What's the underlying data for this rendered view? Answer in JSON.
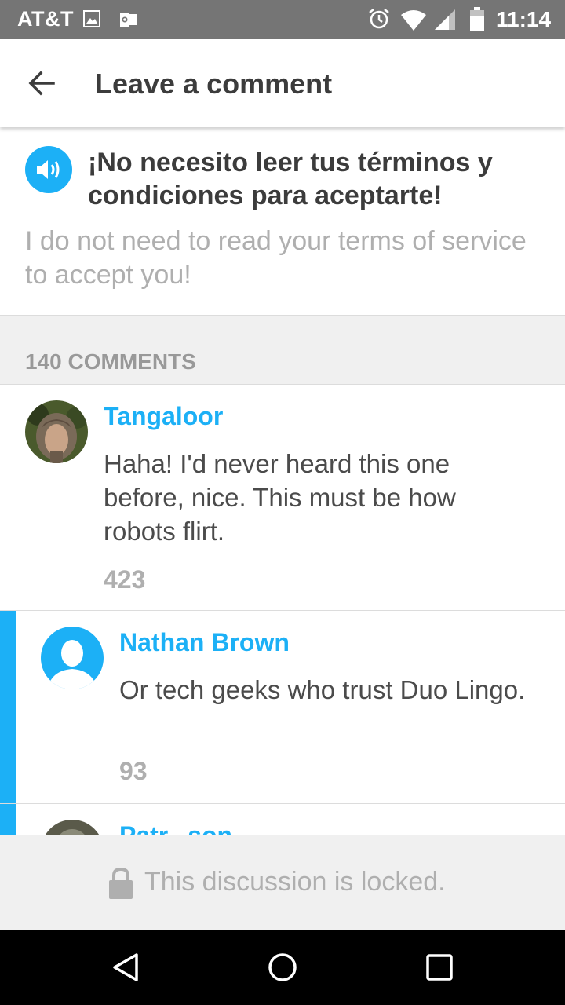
{
  "status_bar": {
    "carrier": "AT&T",
    "time": "11:14",
    "icons": [
      "image-icon",
      "outlook-icon",
      "alarm-icon",
      "wifi-icon",
      "signal-icon",
      "battery-icon"
    ]
  },
  "app_bar": {
    "back_icon": "arrow-left-icon",
    "title": "Leave a comment"
  },
  "sentence": {
    "speaker_icon": "speaker-icon",
    "text": "¡No necesito leer tus términos y condiciones para aceptarte!",
    "translation": "I do not need to read your terms of service to accept you!"
  },
  "comments_header": {
    "count_label": "140 COMMENTS"
  },
  "comments": [
    {
      "author": "Tangaloor",
      "text": "Haha! I'd never heard this one before, nice. This must be how robots flirt.",
      "score": "423",
      "is_reply": false
    },
    {
      "author": "Nathan Brown",
      "text": "Or tech geeks who trust Duo Lingo.",
      "score": "93",
      "is_reply": true
    },
    {
      "author": "Patr...son",
      "is_reply": true
    }
  ],
  "locked_footer": {
    "icon": "lock-icon",
    "text": "This discussion is locked."
  },
  "nav_bar": {
    "icons": [
      "nav-back-icon",
      "nav-home-icon",
      "nav-recents-icon"
    ]
  },
  "colors": {
    "accent": "#1cb0f6",
    "status_bar": "#757575",
    "text_dark": "#3c3c3c",
    "text_muted": "#afafaf",
    "section_bg": "#f0f0f0"
  }
}
